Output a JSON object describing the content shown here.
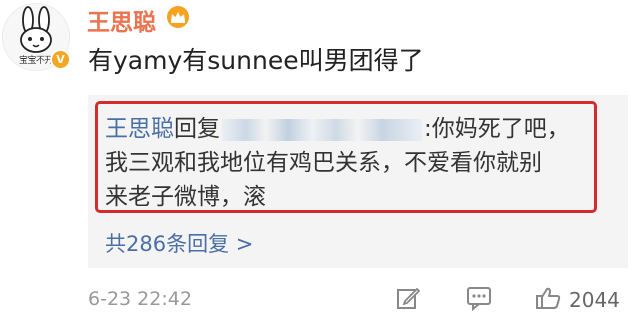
{
  "post": {
    "avatar_caption": "宝宝不开",
    "verified_mark": "V",
    "username": "王思聪",
    "crown_icon": "crown-icon",
    "text": "有yamy有sunnee叫男团得了"
  },
  "reply": {
    "author": "王思聪",
    "reply_word": "回复",
    "after_blur": ":你妈死了吧，",
    "line2": "我三观和我地位有鸡巴关系，不爱看你就别",
    "line3": "来老子微博，滚",
    "count_link": "共286条回复 >"
  },
  "footer": {
    "timestamp": "6-23 22:42",
    "like_count": "2044",
    "actions": [
      "edit-icon",
      "comment-icon",
      "thumbs-up-icon"
    ]
  },
  "colors": {
    "username": "#eb7350",
    "link": "#4a6fa5",
    "highlight_border": "#d62b2b",
    "reply_bg": "#f4f4f4"
  }
}
